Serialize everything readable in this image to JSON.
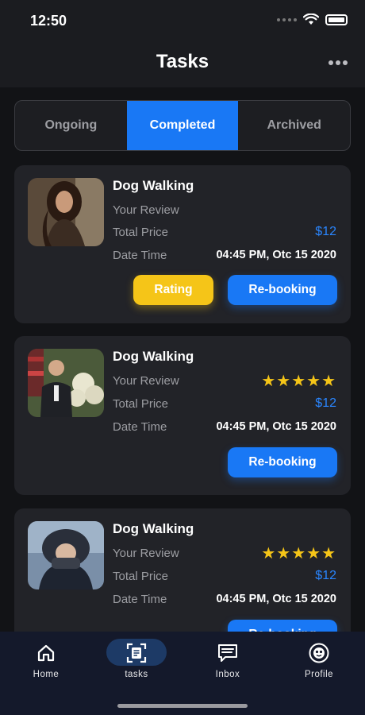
{
  "status_bar": {
    "time": "12:50"
  },
  "header": {
    "title": "Tasks"
  },
  "tabs": [
    {
      "label": "Ongoing",
      "active": false
    },
    {
      "label": "Completed",
      "active": true
    },
    {
      "label": "Archived",
      "active": false
    }
  ],
  "cards": [
    {
      "title": "Dog Walking",
      "review_label": "Your Review",
      "review_stars": "",
      "price_label": "Total Price",
      "price": "$12",
      "date_label": "Date Time",
      "date": "04:45 PM, Otc 15 2020",
      "rating_button": "Rating",
      "rebook_button": "Re-booking"
    },
    {
      "title": "Dog Walking",
      "review_label": "Your Review",
      "review_stars": "★★★★★",
      "price_label": "Total Price",
      "price": "$12",
      "date_label": "Date Time",
      "date": "04:45 PM, Otc 15 2020",
      "rebook_button": "Re-booking"
    },
    {
      "title": "Dog Walking",
      "review_label": "Your Review",
      "review_stars": "★★★★★",
      "price_label": "Total Price",
      "price": "$12",
      "date_label": "Date Time",
      "date": "04:45 PM, Otc 15 2020",
      "rebook_button": "Re-booking"
    }
  ],
  "bottom_nav": [
    {
      "label": "Home",
      "icon": "home-icon"
    },
    {
      "label": "tasks",
      "icon": "tasks-icon",
      "active": true
    },
    {
      "label": "Inbox",
      "icon": "inbox-icon"
    },
    {
      "label": "Profile",
      "icon": "profile-icon"
    }
  ],
  "colors": {
    "accent": "#1978f5",
    "rating": "#f5c518",
    "background": "#121316",
    "card": "#222328"
  }
}
